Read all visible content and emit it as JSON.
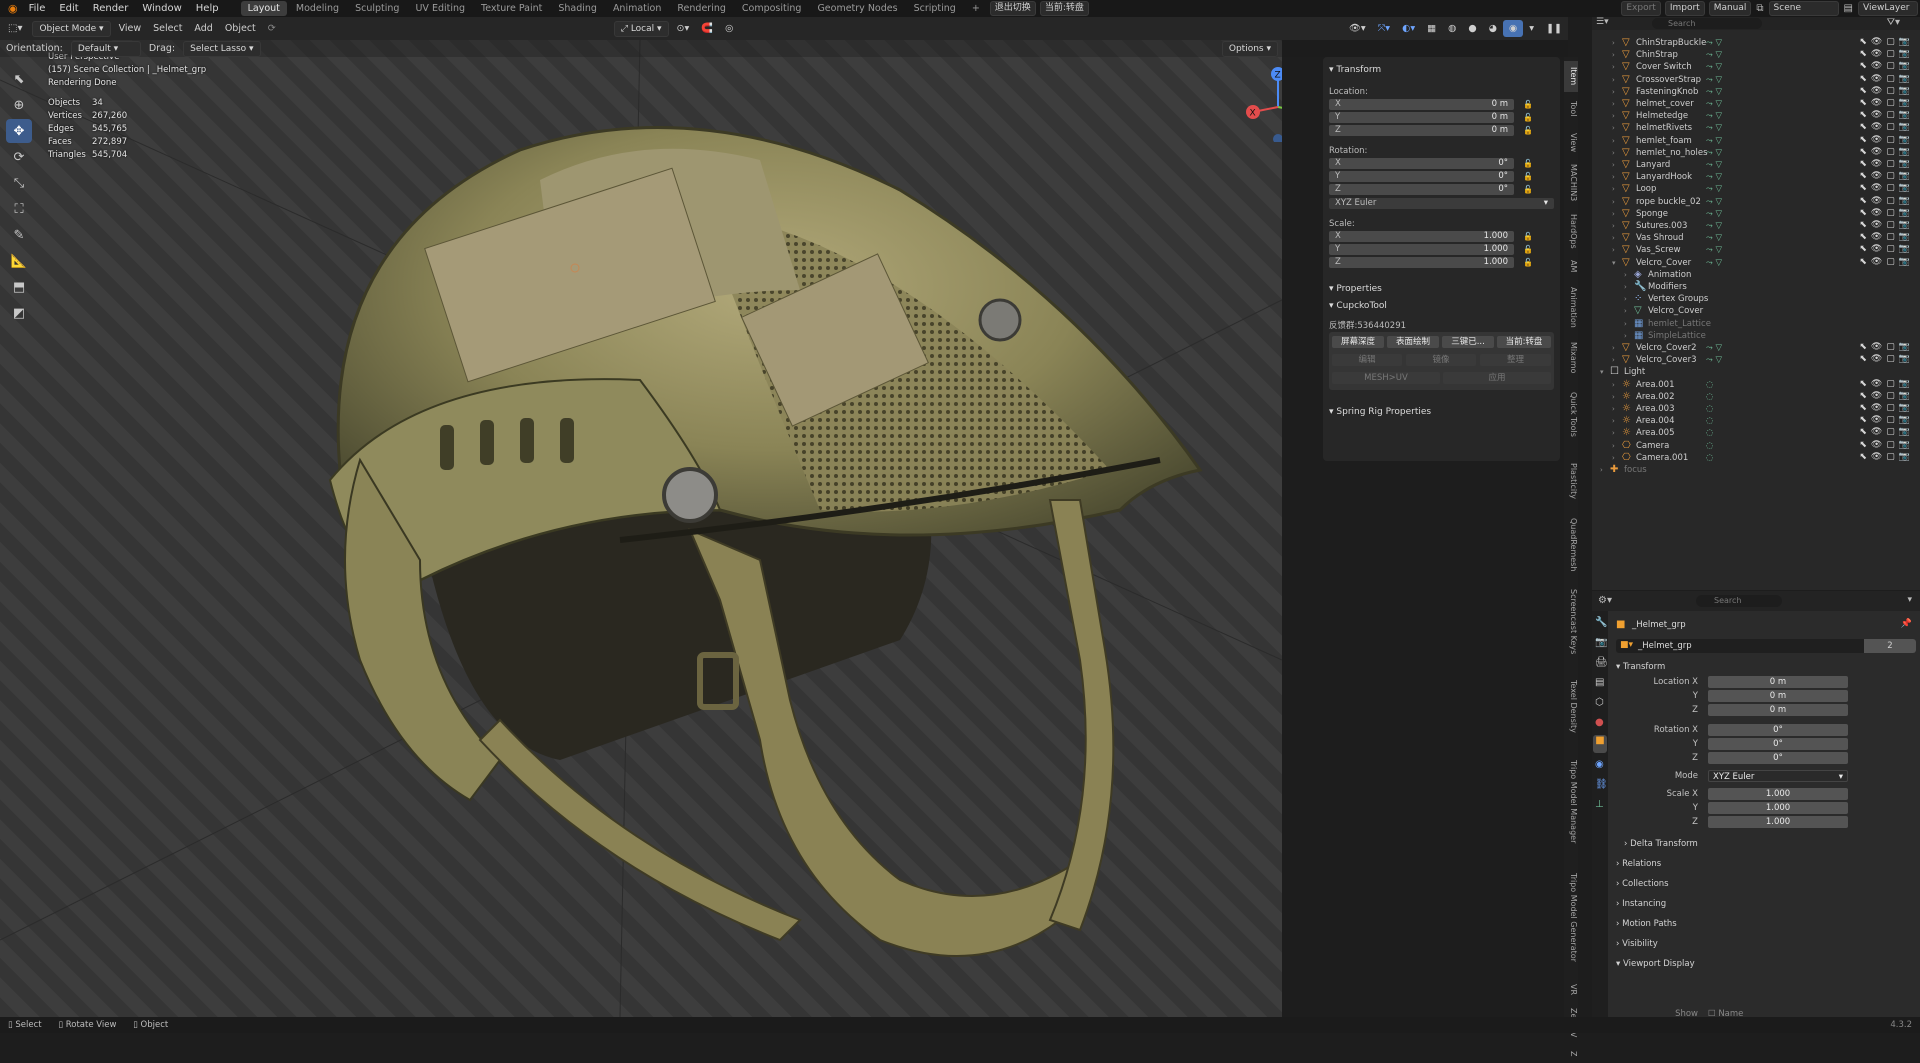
{
  "topbar": {
    "menus": [
      "File",
      "Edit",
      "Render",
      "Window",
      "Help"
    ],
    "workspaces": [
      "Layout",
      "Modeling",
      "Sculpting",
      "UV Editing",
      "Texture Paint",
      "Shading",
      "Animation",
      "Rendering",
      "Compositing",
      "Geometry Nodes",
      "Scripting"
    ],
    "active_workspace": "Layout",
    "add_tab": "+",
    "cn_buttons": [
      "退出切换",
      "当前:转盘"
    ],
    "export": "Export",
    "import": "Import",
    "manual": "Manual",
    "scene": "Scene",
    "view_layer": "ViewLayer"
  },
  "header3d": {
    "mode": "Object Mode",
    "menus": [
      "View",
      "Select",
      "Add",
      "Object"
    ],
    "transform_orientation": "Local",
    "orientation_label": "Orientation:",
    "orientation_value": "Default",
    "drag_label": "Drag:",
    "drag_value": "Select Lasso",
    "options": "Options",
    "search_placeholder": "Search"
  },
  "overlay": {
    "line1": "User Perspective",
    "line2": "(157) Scene Collection | _Helmet_grp",
    "line3": "Rendering Done",
    "stats": [
      {
        "k": "Objects",
        "v": "34"
      },
      {
        "k": "Vertices",
        "v": "267,260"
      },
      {
        "k": "Edges",
        "v": "545,765"
      },
      {
        "k": "Faces",
        "v": "272,897"
      },
      {
        "k": "Triangles",
        "v": "545,704"
      }
    ]
  },
  "gizmo": {
    "x": "X",
    "y": "Y",
    "z": "Z"
  },
  "npanel": {
    "transform_title": "Transform",
    "location_label": "Location:",
    "location": [
      {
        "k": "X",
        "v": "0 m"
      },
      {
        "k": "Y",
        "v": "0 m"
      },
      {
        "k": "Z",
        "v": "0 m"
      }
    ],
    "rotation_label": "Rotation:",
    "rotation": [
      {
        "k": "X",
        "v": "0°"
      },
      {
        "k": "Y",
        "v": "0°"
      },
      {
        "k": "Z",
        "v": "0°"
      }
    ],
    "rotation_mode": "XYZ Euler",
    "scale_label": "Scale:",
    "scale": [
      {
        "k": "X",
        "v": "1.000"
      },
      {
        "k": "Y",
        "v": "1.000"
      },
      {
        "k": "Z",
        "v": "1.000"
      }
    ],
    "properties_title": "Properties",
    "cupcko_title": "CupckoTool",
    "feedback": "反馈群:536440291",
    "tool_buttons": [
      "屏幕深度",
      "表面绘制",
      "三键已...",
      "当前:转盘"
    ],
    "tool_buttons2": [
      "编辑",
      "镜像",
      "整理"
    ],
    "tool_buttons3": [
      "MESH>UV",
      "应用"
    ],
    "spring_title": "Spring Rig Properties"
  },
  "vtabs": [
    "Item",
    "Tool",
    "View",
    "MACHIN3",
    "HardOps",
    "AM",
    "Animation",
    "Mixamo",
    "Quick Tools",
    "Plasticity",
    "QuadRemesh",
    "Screencast Keys",
    "Texel Density",
    "Tripo Model Manager",
    "Tripo Model Generator",
    "VR",
    "Zen UV",
    "Z"
  ],
  "outliner": {
    "search_placeholder": "Search",
    "rows": [
      {
        "name": "ChinStrapBuckle",
        "indent": 2,
        "icon": "mesh"
      },
      {
        "name": "ChinStrap",
        "indent": 2,
        "icon": "mesh"
      },
      {
        "name": "Cover Switch",
        "indent": 2,
        "icon": "mesh"
      },
      {
        "name": "CrossoverStrap",
        "indent": 2,
        "icon": "mesh"
      },
      {
        "name": "FasteningKnob",
        "indent": 2,
        "icon": "mesh"
      },
      {
        "name": "helmet_cover",
        "indent": 2,
        "icon": "mesh"
      },
      {
        "name": "Helmetedge",
        "indent": 2,
        "icon": "mesh"
      },
      {
        "name": "helmetRivets",
        "indent": 2,
        "icon": "mesh"
      },
      {
        "name": "hemlet_foam",
        "indent": 2,
        "icon": "mesh"
      },
      {
        "name": "hemlet_no_holes",
        "indent": 2,
        "icon": "mesh"
      },
      {
        "name": "Lanyard",
        "indent": 2,
        "icon": "mesh"
      },
      {
        "name": "LanyardHook",
        "indent": 2,
        "icon": "mesh"
      },
      {
        "name": "Loop",
        "indent": 2,
        "icon": "mesh"
      },
      {
        "name": "rope buckle_02",
        "indent": 2,
        "icon": "mesh"
      },
      {
        "name": "Sponge",
        "indent": 2,
        "icon": "mesh"
      },
      {
        "name": "Sutures.003",
        "indent": 2,
        "icon": "mesh"
      },
      {
        "name": "Vas Shroud",
        "indent": 2,
        "icon": "mesh"
      },
      {
        "name": "Vas_Screw",
        "indent": 2,
        "icon": "mesh"
      },
      {
        "name": "Velcro_Cover",
        "indent": 2,
        "icon": "mesh"
      },
      {
        "name": "Animation",
        "indent": 3,
        "icon": "anim"
      },
      {
        "name": "Modifiers",
        "indent": 3,
        "icon": "wrench"
      },
      {
        "name": "Vertex Groups",
        "indent": 3,
        "icon": "vgroup"
      },
      {
        "name": "Velcro_Cover",
        "indent": 3,
        "icon": "data"
      },
      {
        "name": "hemlet_Lattice",
        "indent": 3,
        "icon": "lattice"
      },
      {
        "name": "SimpleLattice",
        "indent": 3,
        "icon": "lattice"
      },
      {
        "name": "Velcro_Cover2",
        "indent": 2,
        "icon": "mesh"
      },
      {
        "name": "Velcro_Cover3",
        "indent": 2,
        "icon": "mesh"
      },
      {
        "name": "Light",
        "indent": 1,
        "icon": "collection"
      },
      {
        "name": "Area.001",
        "indent": 2,
        "icon": "light"
      },
      {
        "name": "Area.002",
        "indent": 2,
        "icon": "light"
      },
      {
        "name": "Area.003",
        "indent": 2,
        "icon": "light"
      },
      {
        "name": "Area.004",
        "indent": 2,
        "icon": "light"
      },
      {
        "name": "Area.005",
        "indent": 2,
        "icon": "light"
      },
      {
        "name": "Camera",
        "indent": 2,
        "icon": "camera"
      },
      {
        "name": "Camera.001",
        "indent": 2,
        "icon": "camera"
      },
      {
        "name": "focus",
        "indent": 1,
        "icon": "empty"
      }
    ]
  },
  "props": {
    "search_placeholder": "Search",
    "object_name": "_Helmet_grp",
    "datablock_name": "_Helmet_grp",
    "users": "2",
    "transform_title": "Transform",
    "location": [
      {
        "k": "Location X",
        "v": "0 m"
      },
      {
        "k": "Y",
        "v": "0 m"
      },
      {
        "k": "Z",
        "v": "0 m"
      }
    ],
    "rotation": [
      {
        "k": "Rotation X",
        "v": "0°"
      },
      {
        "k": "Y",
        "v": "0°"
      },
      {
        "k": "Z",
        "v": "0°"
      }
    ],
    "mode_label": "Mode",
    "mode_value": "XYZ Euler",
    "scale": [
      {
        "k": "Scale X",
        "v": "1.000"
      },
      {
        "k": "Y",
        "v": "1.000"
      },
      {
        "k": "Z",
        "v": "1.000"
      }
    ],
    "sections": [
      "Delta Transform",
      "Relations",
      "Collections",
      "Instancing",
      "Motion Paths",
      "Visibility",
      "Viewport Display"
    ],
    "show_label": "Show",
    "show_value": "Name"
  },
  "statusbar": {
    "items": [
      "Select",
      "Rotate View",
      "Object"
    ],
    "version": "4.3.2"
  },
  "colors": {
    "accent": "#4772b3",
    "active_tab": "#3d3d3d",
    "helmet": "#8a8456"
  }
}
